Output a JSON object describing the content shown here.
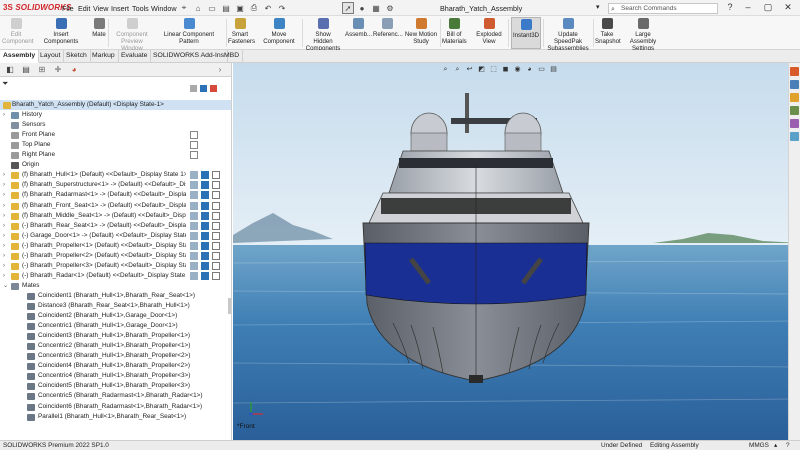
{
  "app": {
    "brand": "SOLIDWORKS",
    "doc_title": "Bharath_Yatch_Assembly"
  },
  "menu": [
    "File",
    "Edit",
    "View",
    "Insert",
    "Tools",
    "Window"
  ],
  "search": {
    "placeholder": "Search Commands"
  },
  "ribbon": [
    {
      "label1": "Edit",
      "label2": "Component",
      "disabled": true,
      "icon": "edit-component-icon"
    },
    {
      "label1": "Insert Components",
      "label2": "",
      "disabled": false,
      "icon": "insert-components-icon"
    },
    {
      "label1": "Mate",
      "label2": "",
      "disabled": false,
      "icon": "mate-icon"
    },
    {
      "label1": "Component",
      "label2": "Preview Window",
      "disabled": true,
      "icon": "preview-window-icon"
    },
    {
      "label1": "Linear Component Pattern",
      "label2": "",
      "disabled": false,
      "icon": "linear-pattern-icon"
    },
    {
      "label1": "Smart",
      "label2": "Fasteners",
      "disabled": false,
      "icon": "smart-fasteners-icon"
    },
    {
      "label1": "Move Component",
      "label2": "",
      "disabled": false,
      "icon": "move-component-icon"
    },
    {
      "label1": "Show Hidden",
      "label2": "Components",
      "disabled": false,
      "icon": "show-hidden-icon"
    },
    {
      "label1": "Assemb...",
      "label2": "",
      "disabled": false,
      "icon": "assembly-features-icon"
    },
    {
      "label1": "Referenc...",
      "label2": "",
      "disabled": false,
      "icon": "reference-geometry-icon"
    },
    {
      "label1": "New Motion",
      "label2": "Study",
      "disabled": false,
      "icon": "motion-study-icon"
    },
    {
      "label1": "Bill of",
      "label2": "Materials",
      "disabled": false,
      "icon": "bom-icon"
    },
    {
      "label1": "Exploded View",
      "label2": "",
      "disabled": false,
      "icon": "exploded-view-icon"
    },
    {
      "label1": "Instant3D",
      "label2": "",
      "disabled": false,
      "active": true,
      "icon": "instant3d-icon"
    },
    {
      "label1": "Update SpeedPak",
      "label2": "Subassemblies",
      "disabled": false,
      "icon": "speedpak-icon"
    },
    {
      "label1": "Take",
      "label2": "Snapshot",
      "disabled": false,
      "icon": "snapshot-icon"
    },
    {
      "label1": "Large Assembly",
      "label2": "Settings",
      "disabled": false,
      "icon": "large-assembly-icon"
    }
  ],
  "tabs": [
    "Assembly",
    "Layout",
    "Sketch",
    "Markup",
    "Evaluate",
    "SOLIDWORKS Add-Ins",
    "MBD"
  ],
  "tree": {
    "root": "Bharath_Yatch_Assembly (Default) <Display State-1>",
    "rows": [
      {
        "label": "History",
        "icon": "history-icon",
        "color": "#6f8faa",
        "indent": 1,
        "expand": "›"
      },
      {
        "label": "Sensors",
        "icon": "sensors-icon",
        "color": "#7f8f9f",
        "indent": 1,
        "expand": ""
      },
      {
        "label": "Front Plane",
        "icon": "plane-icon",
        "color": "#9a9a9a",
        "indent": 1,
        "expand": ""
      },
      {
        "label": "Top Plane",
        "icon": "plane-icon",
        "color": "#9a9a9a",
        "indent": 1,
        "expand": ""
      },
      {
        "label": "Right Plane",
        "icon": "plane-icon",
        "color": "#9a9a9a",
        "indent": 1,
        "expand": ""
      },
      {
        "label": "Origin",
        "icon": "origin-icon",
        "color": "#555555",
        "indent": 1,
        "expand": ""
      },
      {
        "label": "(f) Bharath_Hull<1> (Default) <<Default>_Display State 1>",
        "icon": "part-icon",
        "color": "#e2b53a",
        "indent": 1,
        "expand": "›"
      },
      {
        "label": "(f) Bharath_Superstructure<1> -> (Default) <<Default>_Disp",
        "icon": "part-icon",
        "color": "#e2b53a",
        "indent": 1,
        "expand": "›"
      },
      {
        "label": "(f) Bharath_Radarmast<1> -> (Default) <<Default>_Display",
        "icon": "part-icon",
        "color": "#e2b53a",
        "indent": 1,
        "expand": "›"
      },
      {
        "label": "(f) Bharath_Front_Seat<1> -> (Default) <<Default>_Display",
        "icon": "part-icon",
        "color": "#e2b53a",
        "indent": 1,
        "expand": "›"
      },
      {
        "label": "(f) Bharath_Middle_Seat<1> -> (Default) <<Default>_Display",
        "icon": "part-icon",
        "color": "#e2b53a",
        "indent": 1,
        "expand": "›"
      },
      {
        "label": "(-) Bharath_Rear_Seat<1> -> (Default) <<Default>_Display St",
        "icon": "part-icon",
        "color": "#e2b53a",
        "indent": 1,
        "expand": "›"
      },
      {
        "label": "(-) Garage_Door<1> -> (Default) <<Default>_Display State",
        "icon": "part-icon",
        "color": "#e2b53a",
        "indent": 1,
        "expand": "›"
      },
      {
        "label": "(-) Bharath_Propeller<1> (Default) <<Default>_Display State",
        "icon": "part-icon",
        "color": "#e2b53a",
        "indent": 1,
        "expand": "›"
      },
      {
        "label": "(-) Bharath_Propeller<2> (Default) <<Default>_Display State",
        "icon": "part-icon",
        "color": "#e2b53a",
        "indent": 1,
        "expand": "›"
      },
      {
        "label": "(-) Bharath_Propeller<3> (Default) <<Default>_Display State",
        "icon": "part-icon",
        "color": "#e2b53a",
        "indent": 1,
        "expand": "›"
      },
      {
        "label": "(-) Bharath_Radar<1> (Default) <<Default>_Display State 1>",
        "icon": "part-icon",
        "color": "#e2b53a",
        "indent": 1,
        "expand": "›"
      },
      {
        "label": "Mates",
        "icon": "mates-icon",
        "color": "#7c8896",
        "indent": 1,
        "expand": "⌄"
      },
      {
        "label": "Coincident1 (Bharath_Hull<1>,Bharath_Rear_Seat<1>)",
        "icon": "coincident-icon",
        "color": "#6b7785",
        "indent": 2,
        "expand": ""
      },
      {
        "label": "Distance3 (Bharath_Rear_Seat<1>,Bharath_Hull<1>)",
        "icon": "distance-icon",
        "color": "#6b7785",
        "indent": 2,
        "expand": ""
      },
      {
        "label": "Coincident2 (Bharath_Hull<1>,Garage_Door<1>)",
        "icon": "coincident-icon",
        "color": "#6b7785",
        "indent": 2,
        "expand": ""
      },
      {
        "label": "Concentric1 (Bharath_Hull<1>,Garage_Door<1>)",
        "icon": "concentric-icon",
        "color": "#6b7785",
        "indent": 2,
        "expand": ""
      },
      {
        "label": "Coincident3 (Bharath_Hull<1>,Bharath_Propeller<1>)",
        "icon": "coincident-icon",
        "color": "#6b7785",
        "indent": 2,
        "expand": ""
      },
      {
        "label": "Concentric2 (Bharath_Hull<1>,Bharath_Propeller<1>)",
        "icon": "concentric-icon",
        "color": "#6b7785",
        "indent": 2,
        "expand": ""
      },
      {
        "label": "Concentric3 (Bharath_Hull<1>,Bharath_Propeller<2>)",
        "icon": "concentric-icon",
        "color": "#6b7785",
        "indent": 2,
        "expand": ""
      },
      {
        "label": "Coincident4 (Bharath_Hull<1>,Bharath_Propeller<2>)",
        "icon": "coincident-icon",
        "color": "#6b7785",
        "indent": 2,
        "expand": ""
      },
      {
        "label": "Concentric4 (Bharath_Hull<1>,Bharath_Propeller<3>)",
        "icon": "concentric-icon",
        "color": "#6b7785",
        "indent": 2,
        "expand": ""
      },
      {
        "label": "Coincident5 (Bharath_Hull<1>,Bharath_Propeller<3>)",
        "icon": "coincident-icon",
        "color": "#6b7785",
        "indent": 2,
        "expand": ""
      },
      {
        "label": "Concentric5 (Bharath_Radarmast<1>,Bharath_Radar<1>)",
        "icon": "concentric-icon",
        "color": "#6b7785",
        "indent": 2,
        "expand": ""
      },
      {
        "label": "Coincident6 (Bharath_Radarmast<1>,Bharath_Radar<1>)",
        "icon": "coincident-icon",
        "color": "#6b7785",
        "indent": 2,
        "expand": ""
      },
      {
        "label": "Parallel1 (Bharath_Hull<1>,Bharath_Rear_Seat<1>)",
        "icon": "parallel-icon",
        "color": "#6b7785",
        "indent": 2,
        "expand": ""
      }
    ]
  },
  "viewport": {
    "view_label": "*Front"
  },
  "status": {
    "product": "SOLIDWORKS Premium 2022 SP1.0",
    "state": "Under Defined",
    "mode": "Editing Assembly",
    "units": "MMGS"
  },
  "colors": {
    "accent": "#d0262c",
    "hull_stripe": "#1a2f93",
    "sea": "#2f6fa6"
  }
}
